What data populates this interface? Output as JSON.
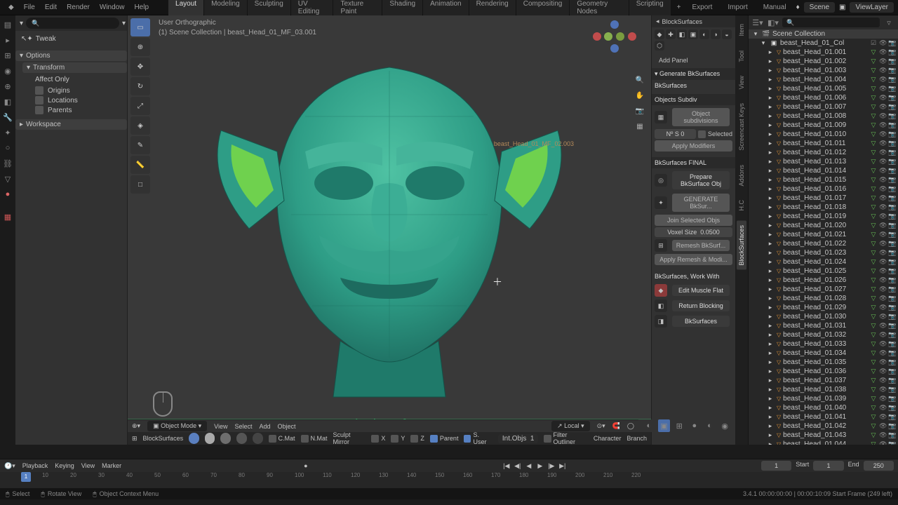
{
  "topbar": {
    "logo": "⊞",
    "menus": [
      "File",
      "Edit",
      "Render",
      "Window",
      "Help"
    ],
    "workspaces": [
      "Layout",
      "Modeling",
      "Sculpting",
      "UV Editing",
      "Texture Paint",
      "Shading",
      "Animation",
      "Rendering",
      "Compositing",
      "Geometry Nodes",
      "Scripting"
    ],
    "active_ws": 0,
    "right": {
      "export": "Export",
      "import": "Import",
      "manual": "Manual",
      "scene": "Scene",
      "layer": "ViewLayer"
    }
  },
  "left_panel": {
    "tweak": "Tweak",
    "options": "Options",
    "transform": "Transform",
    "affect_only": "Affect Only",
    "origins": "Origins",
    "locations": "Locations",
    "parents": "Parents",
    "workspace": "Workspace"
  },
  "viewport": {
    "view_label": "User Orthographic",
    "collection": "(1) Scene Collection | beast_Head_01_MF_03.001",
    "annotation": "beast_Head_01_MF_02.003",
    "watermark": "BlockSurfaces",
    "modebar": {
      "mode": "Object Mode",
      "menus": [
        "View",
        "Select",
        "Add",
        "Object"
      ],
      "orient": "Local"
    },
    "bottom": {
      "label": "BlockSurfaces",
      "cmat": "C.Mat",
      "nmat": "N.Mat",
      "sculpt_mirror": "Sculpt Mirror",
      "x": "X",
      "y": "Y",
      "z": "Z",
      "parent": "Parent",
      "suser": "S. User",
      "intobjs": "Int.Objs",
      "intobjs_val": "1",
      "filter": "Filter Outliner",
      "character": "Character",
      "branch": "Branch"
    }
  },
  "npanel": {
    "title": "BlockSurfaces",
    "add_panel": "Add Panel",
    "generate": "Generate BkSurfaces",
    "bksurfaces": "BkSurfaces",
    "subdiv_h": "Objects Subdiv",
    "obj_subdiv": "Object subdivisions",
    "nos": "Nº S",
    "nos_val": "0",
    "selected": "Selected",
    "apply_mod": "Apply Modifiers",
    "final_h": "BkSurfaces FINAL",
    "prepare": "Prepare BkSurface Obj",
    "generate_bk": "GENERATE BkSur...",
    "join": "Join Selected Objs",
    "voxel": "Voxel Size",
    "voxel_val": "0.0500",
    "remesh": "Remesh BkSurf...",
    "apply_remesh": "Apply Remesh & Modi...",
    "work_with": "BkSurfaces, Work With",
    "edit_muscle": "Edit Muscle Flat",
    "return_blocking": "Return Blocking",
    "bksurf_btn": "BkSurfaces"
  },
  "vtabs": [
    "Item",
    "Tool",
    "View",
    "Screencast Keys",
    "Addons",
    "H.C",
    "BlockSurfaces"
  ],
  "outliner": {
    "scene": "Scene Collection",
    "col": "beast_Head_01_Col",
    "prefix": "beast_Head_01.",
    "count": 45
  },
  "timeline": {
    "menus": [
      "Playback",
      "Keying",
      "View",
      "Marker"
    ],
    "curframe": "1",
    "start_label": "Start",
    "start": "1",
    "end_label": "End",
    "end": "250",
    "ticks": [
      "10",
      "20",
      "30",
      "40",
      "50",
      "60",
      "70",
      "80",
      "90",
      "100",
      "110",
      "120",
      "130",
      "140",
      "150",
      "160",
      "170",
      "180",
      "190",
      "200",
      "210",
      "220"
    ]
  },
  "status": {
    "select": "Select",
    "rotate": "Rotate View",
    "context": "Object Context Menu",
    "version": "3.4.1  00:00:00:00 | 00:00:10:09  Start Frame (249 left)"
  }
}
